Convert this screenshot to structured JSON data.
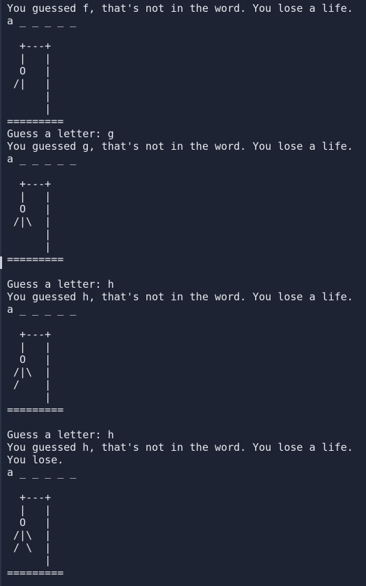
{
  "terminal": {
    "background": "#1d2333",
    "foreground": "#e6e9ef",
    "lines": [
      "You guessed f, that's not in the word. You lose a life.",
      "a _ _ _ _ _",
      "",
      "  +---+",
      "  |   |",
      "  O   |",
      " /|   |",
      "      |",
      "      |",
      "=========",
      "Guess a letter: g",
      "You guessed g, that's not in the word. You lose a life.",
      "a _ _ _ _ _",
      "",
      "  +---+",
      "  |   |",
      "  O   |",
      " /|\\  |",
      "      |",
      "      |",
      "=========",
      "",
      "Guess a letter: h",
      "You guessed h, that's not in the word. You lose a life.",
      "a _ _ _ _ _",
      "",
      "  +---+",
      "  |   |",
      "  O   |",
      " /|\\  |",
      " /    |",
      "      |",
      "=========",
      "",
      "Guess a letter: h",
      "You guessed h, that's not in the word. You lose a life.",
      "You lose.",
      "a _ _ _ _ _",
      "",
      "  +---+",
      "  |   |",
      "  O   |",
      " /|\\  |",
      " / \\  |",
      "      |",
      "========="
    ]
  }
}
